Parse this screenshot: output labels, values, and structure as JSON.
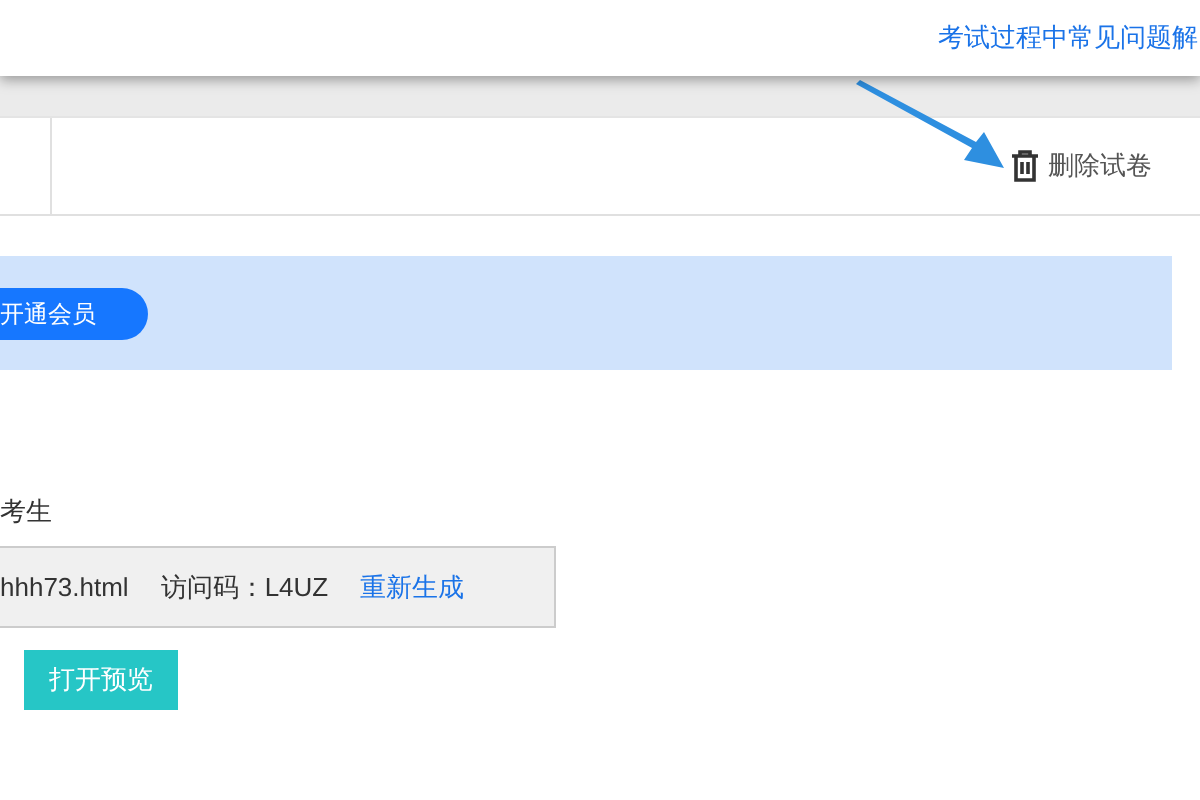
{
  "header": {
    "help_link": "考试过程中常见问题解"
  },
  "toolbar": {
    "delete_label": "删除试卷"
  },
  "banner": {
    "button": "开通会员"
  },
  "section": {
    "label": "考生"
  },
  "link_box": {
    "url": "hhh73.html",
    "code_label": "访问码：",
    "code": "L4UZ",
    "regenerate": "重新生成"
  },
  "preview_button": "打开预览"
}
